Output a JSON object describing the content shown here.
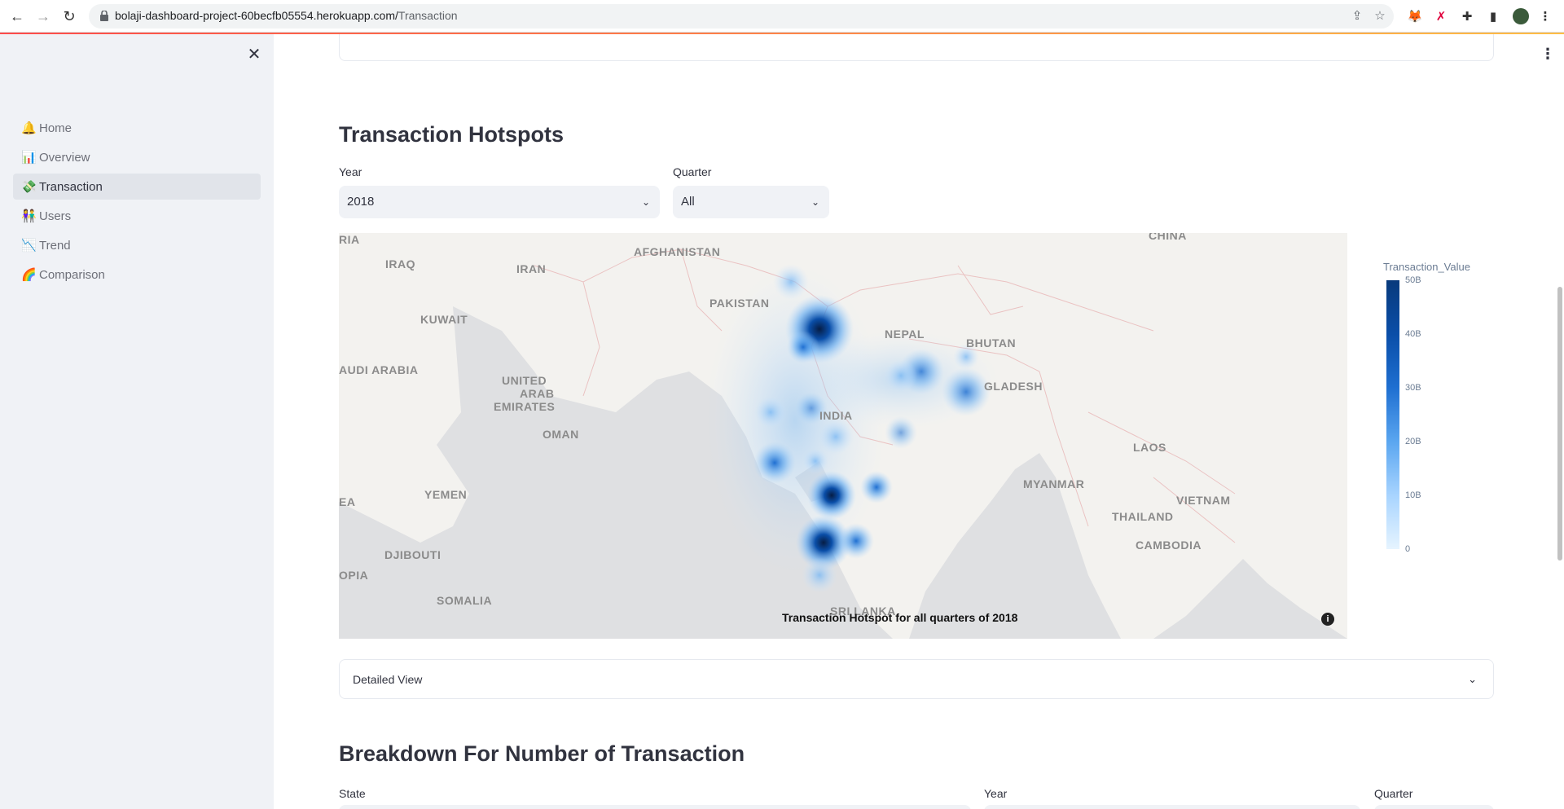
{
  "browser": {
    "url_host": "bolaji-dashboard-project-60becfb05554.herokuapp.com/",
    "url_path": "Transaction"
  },
  "sidebar": {
    "items": [
      {
        "emoji": "🔔",
        "label": "Home"
      },
      {
        "emoji": "📊",
        "label": "Overview"
      },
      {
        "emoji": "💸",
        "label": "Transaction"
      },
      {
        "emoji": "👫",
        "label": "Users"
      },
      {
        "emoji": "📉",
        "label": "Trend"
      },
      {
        "emoji": "🌈",
        "label": "Comparison"
      }
    ],
    "active_index": 2
  },
  "hotspots": {
    "heading": "Transaction Hotspots",
    "year_label": "Year",
    "year_value": "2018",
    "quarter_label": "Quarter",
    "quarter_value": "All",
    "map_title": "Transaction Hotspot for all quarters  of 2018",
    "map_labels": [
      "IRAQ",
      "IRAN",
      "AFGHANISTAN",
      "PAKISTAN",
      "CHINA",
      "KUWAIT",
      "NEPAL",
      "BHUTAN",
      "AUDI ARABIA",
      "UNITED",
      "ARAB",
      "EMIRATES",
      "GLADESH",
      "INDIA",
      "OMAN",
      "LAOS",
      "MYANMAR",
      "YEMEN",
      "VIETNAM",
      "THAILAND",
      "EA",
      "CAMBODIA",
      "DJIBOUTI",
      "OPIA",
      "SOMALIA",
      "SRI LANKA",
      "RIA"
    ],
    "colorbar_title": "Transaction_Value",
    "colorbar_ticks": [
      "50B",
      "40B",
      "30B",
      "20B",
      "10B",
      "0"
    ]
  },
  "detailed_view_label": "Detailed View",
  "breakdown": {
    "heading": "Breakdown For Number of Transaction",
    "state_label": "State",
    "year_label": "Year",
    "quarter_label": "Quarter"
  },
  "colors": {
    "accent": "#ff4b4b",
    "sidebar_bg": "#f0f2f6",
    "hotspot_dark": "#0a2f6b",
    "hotspot_light": "#9cc8f5"
  }
}
